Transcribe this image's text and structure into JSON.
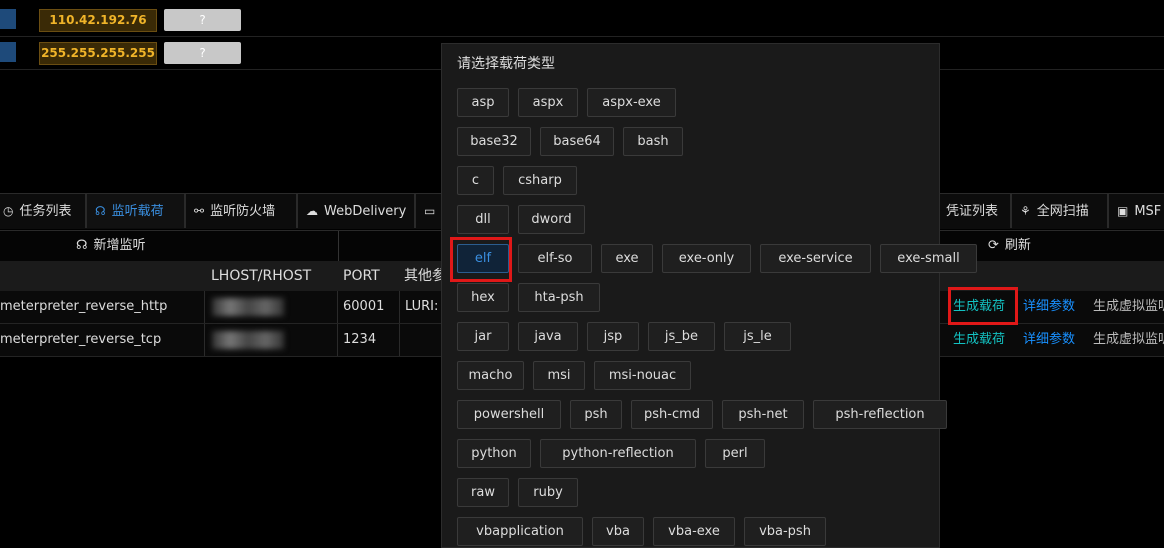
{
  "ip_rows": [
    {
      "ip": "110.42.192.76",
      "button": "?"
    },
    {
      "ip": "255.255.255.255",
      "button": "?"
    }
  ],
  "tabs": [
    {
      "label": "任务列表",
      "icon": "clock-icon",
      "active": false
    },
    {
      "label": "监听载荷",
      "icon": "headphones-icon",
      "active": true
    },
    {
      "label": "监听防火墙",
      "icon": "link-icon",
      "active": false
    },
    {
      "label": "WebDelivery",
      "icon": "cloud-icon",
      "active": false
    },
    {
      "label": "凭证列表",
      "icon": "key-icon",
      "active": false
    },
    {
      "label": "全网扫描",
      "icon": "bug-icon",
      "active": false
    },
    {
      "label": "MSF",
      "icon": "terminal-icon",
      "active": false
    }
  ],
  "actions": {
    "add_listener": "新增监听",
    "refresh": "刷新"
  },
  "table": {
    "headers": {
      "lhost": "LHOST/RHOST",
      "port": "PORT",
      "other": "其他参"
    },
    "rows": [
      {
        "payload": "meterpreter_reverse_http",
        "port": "60001",
        "other": "LURI: ",
        "gen": "生成载荷",
        "detail": "详细参数",
        "virtual": "生成虚拟监听"
      },
      {
        "payload": "meterpreter_reverse_tcp",
        "port": "1234",
        "other": "",
        "gen": "生成载荷",
        "detail": "详细参数",
        "virtual": "生成虚拟监听"
      }
    ]
  },
  "modal": {
    "title": "请选择载荷类型",
    "selected": "elf",
    "rows": [
      [
        "asp",
        "aspx",
        "aspx-exe"
      ],
      [
        "base32",
        "base64",
        "bash"
      ],
      [
        "c",
        "csharp"
      ],
      [
        "dll",
        "dword"
      ],
      [
        "elf",
        "elf-so",
        "exe",
        "exe-only",
        "exe-service",
        "exe-small"
      ],
      [
        "hex",
        "hta-psh"
      ],
      [
        "jar",
        "java",
        "jsp",
        "js_be",
        "js_le"
      ],
      [
        "macho",
        "msi",
        "msi-nouac"
      ],
      [
        "powershell",
        "psh",
        "psh-cmd",
        "psh-net",
        "psh-reflection"
      ],
      [
        "python",
        "python-reflection",
        "perl"
      ],
      [
        "raw",
        "ruby"
      ],
      [
        "vbapplication",
        "vba",
        "vba-exe",
        "vba-psh"
      ]
    ]
  },
  "colors": {
    "accent": "#3a8fe0",
    "green_link": "#13c2c2",
    "blue_link": "#1890ff",
    "highlight": "#e01818",
    "ip_text": "#f0b429"
  }
}
